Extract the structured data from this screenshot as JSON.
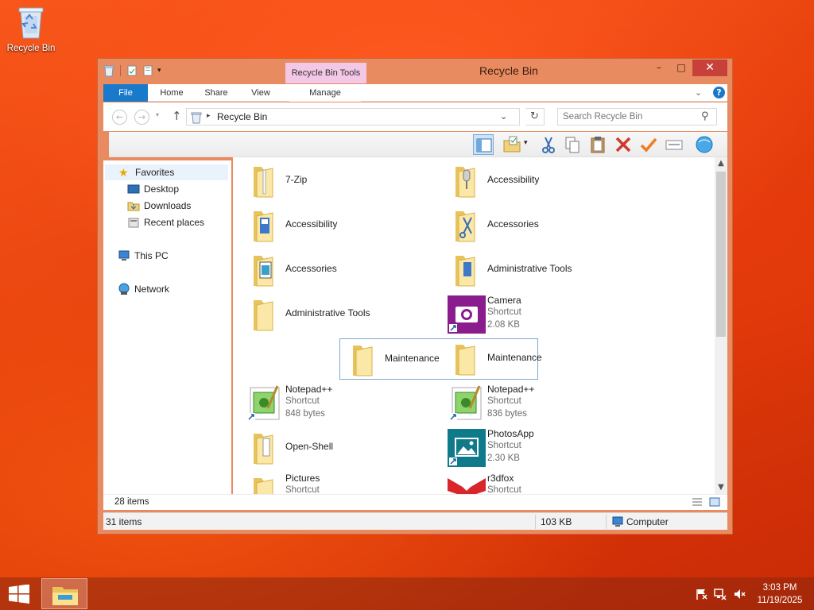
{
  "desktop": {
    "icons": [
      {
        "label": "Recycle Bin",
        "icon": "recycle-bin-icon"
      }
    ]
  },
  "window": {
    "title": "Recycle Bin",
    "contextual_tab": "Recycle Bin Tools",
    "controls": {
      "minimize": "–",
      "maximize": "□",
      "close": "✕"
    }
  },
  "ribbon": {
    "tabs": [
      {
        "label": "File"
      },
      {
        "label": "Home"
      },
      {
        "label": "Share"
      },
      {
        "label": "View"
      },
      {
        "label": "Manage"
      }
    ],
    "help": "?"
  },
  "address_bar": {
    "path": "Recycle Bin",
    "search_placeholder": "Search Recycle Bin"
  },
  "toolbar": {
    "buttons": [
      "preview-pane-icon",
      "properties-icon",
      "cut-icon",
      "copy-icon",
      "paste-icon",
      "delete-icon",
      "rename-icon",
      "select-icon",
      "internet-icon"
    ]
  },
  "nav_pane": {
    "favorites": "Favorites",
    "items": [
      "Desktop",
      "Downloads",
      "Recent places"
    ],
    "this_pc": "This PC",
    "network": "Network"
  },
  "files": [
    {
      "name": "7-Zip",
      "type": "folder",
      "sub1": "",
      "sub2": ""
    },
    {
      "name": "Accessibility",
      "type": "folder-mic",
      "sub1": "",
      "sub2": ""
    },
    {
      "name": "Accessibility",
      "type": "folder-doc",
      "sub1": "",
      "sub2": ""
    },
    {
      "name": "Accessories",
      "type": "folder-tools",
      "sub1": "",
      "sub2": ""
    },
    {
      "name": "Accessories",
      "type": "folder-doc",
      "sub1": "",
      "sub2": ""
    },
    {
      "name": "Administrative Tools",
      "type": "folder-doc",
      "sub1": "",
      "sub2": ""
    },
    {
      "name": "Administrative Tools",
      "type": "folder",
      "sub1": "",
      "sub2": ""
    },
    {
      "name": "Camera",
      "type": "camera",
      "sub1": "Shortcut",
      "sub2": "2.08 KB"
    },
    {
      "name": "Maintenance",
      "type": "folder",
      "sub1": "",
      "sub2": ""
    },
    {
      "name": "Maintenance",
      "type": "folder",
      "sub1": "",
      "sub2": ""
    },
    {
      "name": "Notepad++",
      "type": "notepad",
      "sub1": "Shortcut",
      "sub2": "848 bytes"
    },
    {
      "name": "Notepad++",
      "type": "notepad",
      "sub1": "Shortcut",
      "sub2": "836 bytes"
    },
    {
      "name": "Open-Shell",
      "type": "folder-doc",
      "sub1": "",
      "sub2": ""
    },
    {
      "name": "PhotosApp",
      "type": "photos",
      "sub1": "Shortcut",
      "sub2": "2.30 KB"
    },
    {
      "name": "Pictures",
      "type": "folder",
      "sub1": "Shortcut",
      "sub2": ""
    },
    {
      "name": "r3dfox",
      "type": "r3dfox",
      "sub1": "Shortcut",
      "sub2": ""
    }
  ],
  "inner_status": {
    "count": "28 items"
  },
  "status_bar": {
    "items": "31 items",
    "size": "103 KB",
    "location": "Computer"
  },
  "taskbar": {
    "time": "3:03 PM",
    "date": "11/19/2025"
  },
  "colors": {
    "accent": "#1979ca",
    "titlebar": "#e98b60",
    "contextual": "#f3c7e6",
    "close": "#c7413a"
  }
}
